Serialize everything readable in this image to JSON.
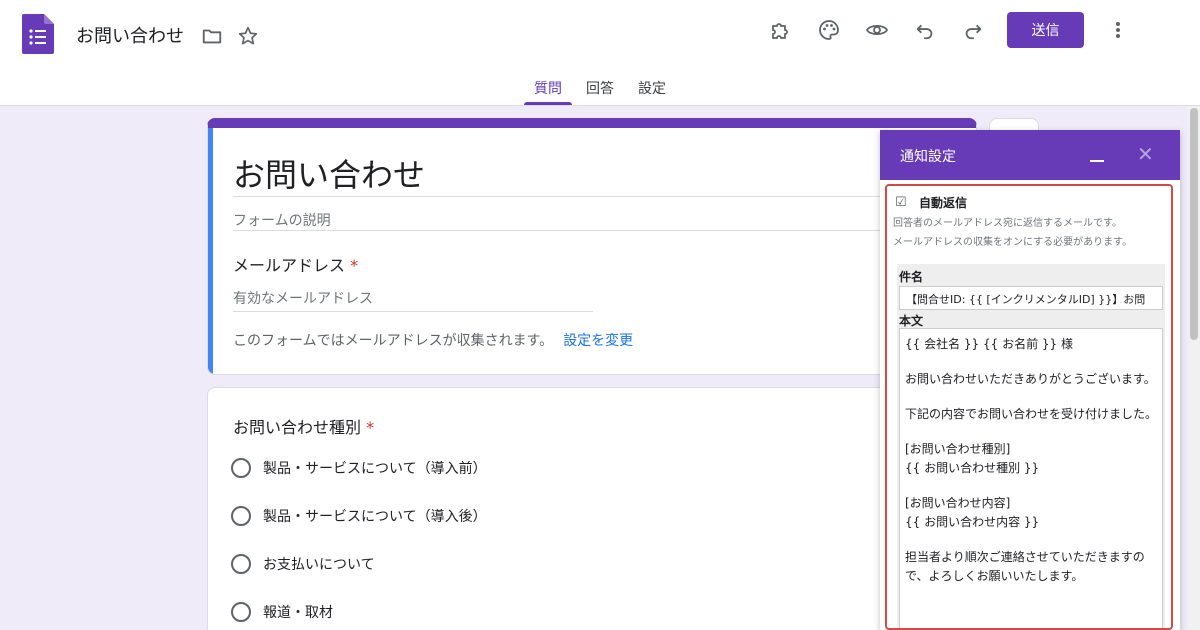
{
  "header": {
    "title": "お問い合わせ",
    "send_label": "送信",
    "tabs": [
      {
        "label": "質問",
        "active": true
      },
      {
        "label": "回答",
        "active": false
      },
      {
        "label": "設定",
        "active": false
      }
    ],
    "icons": [
      "folder-icon",
      "star-icon",
      "addon-icon",
      "palette-icon",
      "preview-eye-icon",
      "undo-icon",
      "redo-icon",
      "more-vert-icon"
    ]
  },
  "form": {
    "title": "お問い合わせ",
    "description_placeholder": "フォームの説明",
    "email_label": "メールアドレス",
    "required_mark": "*",
    "email_placeholder": "有効なメールアドレス",
    "collect_note": "このフォームではメールアドレスが収集されます。",
    "change_link": "設定を変更"
  },
  "question": {
    "title": "お問い合わせ種別",
    "required_mark": "*",
    "options": [
      "製品・サービスについて（導入前）",
      "製品・サービスについて（導入後）",
      "お支払いについて",
      "報道・取材"
    ]
  },
  "notification_panel": {
    "title": "通知設定",
    "auto_reply_label": "自動返信",
    "auto_reply_checked": true,
    "hint_line1": "回答者のメールアドレス宛に返信するメールです。",
    "hint_line2": "メールアドレスの収集をオンにする必要があります。",
    "subject_label": "件名",
    "subject_value": "【問合せID: {{ [インクリメンタルID] }}】お問",
    "body_label": "本文",
    "body_paragraphs": [
      "{{ 会社名 }} {{ お名前 }} 様",
      "お問い合わせいただきありがとうございます。",
      "下記の内容でお問い合わせを受け付けました。",
      "[お問い合わせ種別]\n{{ お問い合わせ種別 }}",
      "[お問い合わせ内容]\n{{ お問い合わせ内容 }}",
      "担当者より順次ご連絡させていただきますので、よろしくお願いいたします。"
    ]
  },
  "colors": {
    "accent": "#673ab7",
    "background": "#f0ebf8",
    "highlight_border": "#d14a4a",
    "link": "#1a73e8",
    "required": "#d93025"
  }
}
